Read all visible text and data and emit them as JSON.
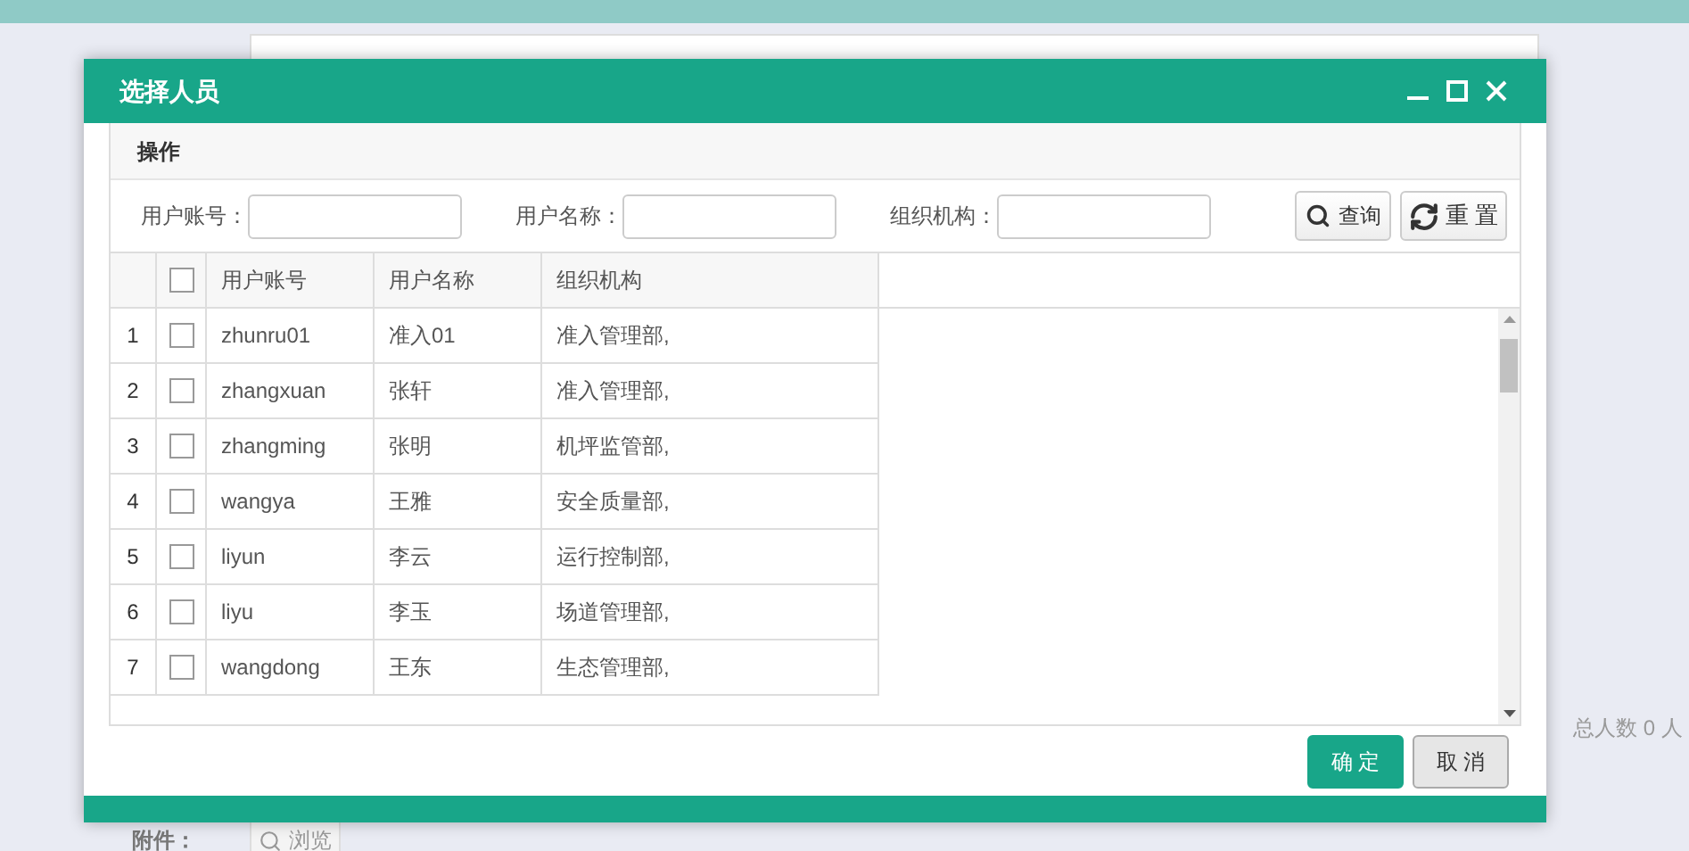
{
  "page": {
    "total": "总人数 0 人",
    "attachment_label": "附件：",
    "browse_button": "浏览"
  },
  "dialog": {
    "title": "选择人员",
    "toolbar_title": "操作",
    "filters": [
      {
        "label": "用户账号："
      },
      {
        "label": "用户名称："
      },
      {
        "label": "组织机构："
      }
    ],
    "search_button": "查询",
    "reset_button": "重 置",
    "table": {
      "columns": [
        "用户账号",
        "用户名称",
        "组织机构"
      ],
      "header_checked": false,
      "rows": [
        {
          "index": "1",
          "checked": false,
          "cells": [
            "zhunru01",
            "准入01",
            "准入管理部,"
          ]
        },
        {
          "index": "2",
          "checked": false,
          "cells": [
            "zhangxuan",
            "张轩",
            "准入管理部,"
          ]
        },
        {
          "index": "3",
          "checked": false,
          "cells": [
            "zhangming",
            "张明",
            "机坪监管部,"
          ]
        },
        {
          "index": "4",
          "checked": false,
          "cells": [
            "wangya",
            "王雅",
            "安全质量部,"
          ]
        },
        {
          "index": "5",
          "checked": false,
          "cells": [
            "liyun",
            "李云",
            "运行控制部,"
          ]
        },
        {
          "index": "6",
          "checked": false,
          "cells": [
            "liyu",
            "李玉",
            "场道管理部,"
          ]
        },
        {
          "index": "7",
          "checked": false,
          "cells": [
            "wangdong",
            "王东",
            "生态管理部,"
          ]
        }
      ]
    },
    "buttons": [
      {
        "label": "确 定",
        "kind": "primary"
      },
      {
        "label": "取 消",
        "kind": "default"
      }
    ]
  }
}
